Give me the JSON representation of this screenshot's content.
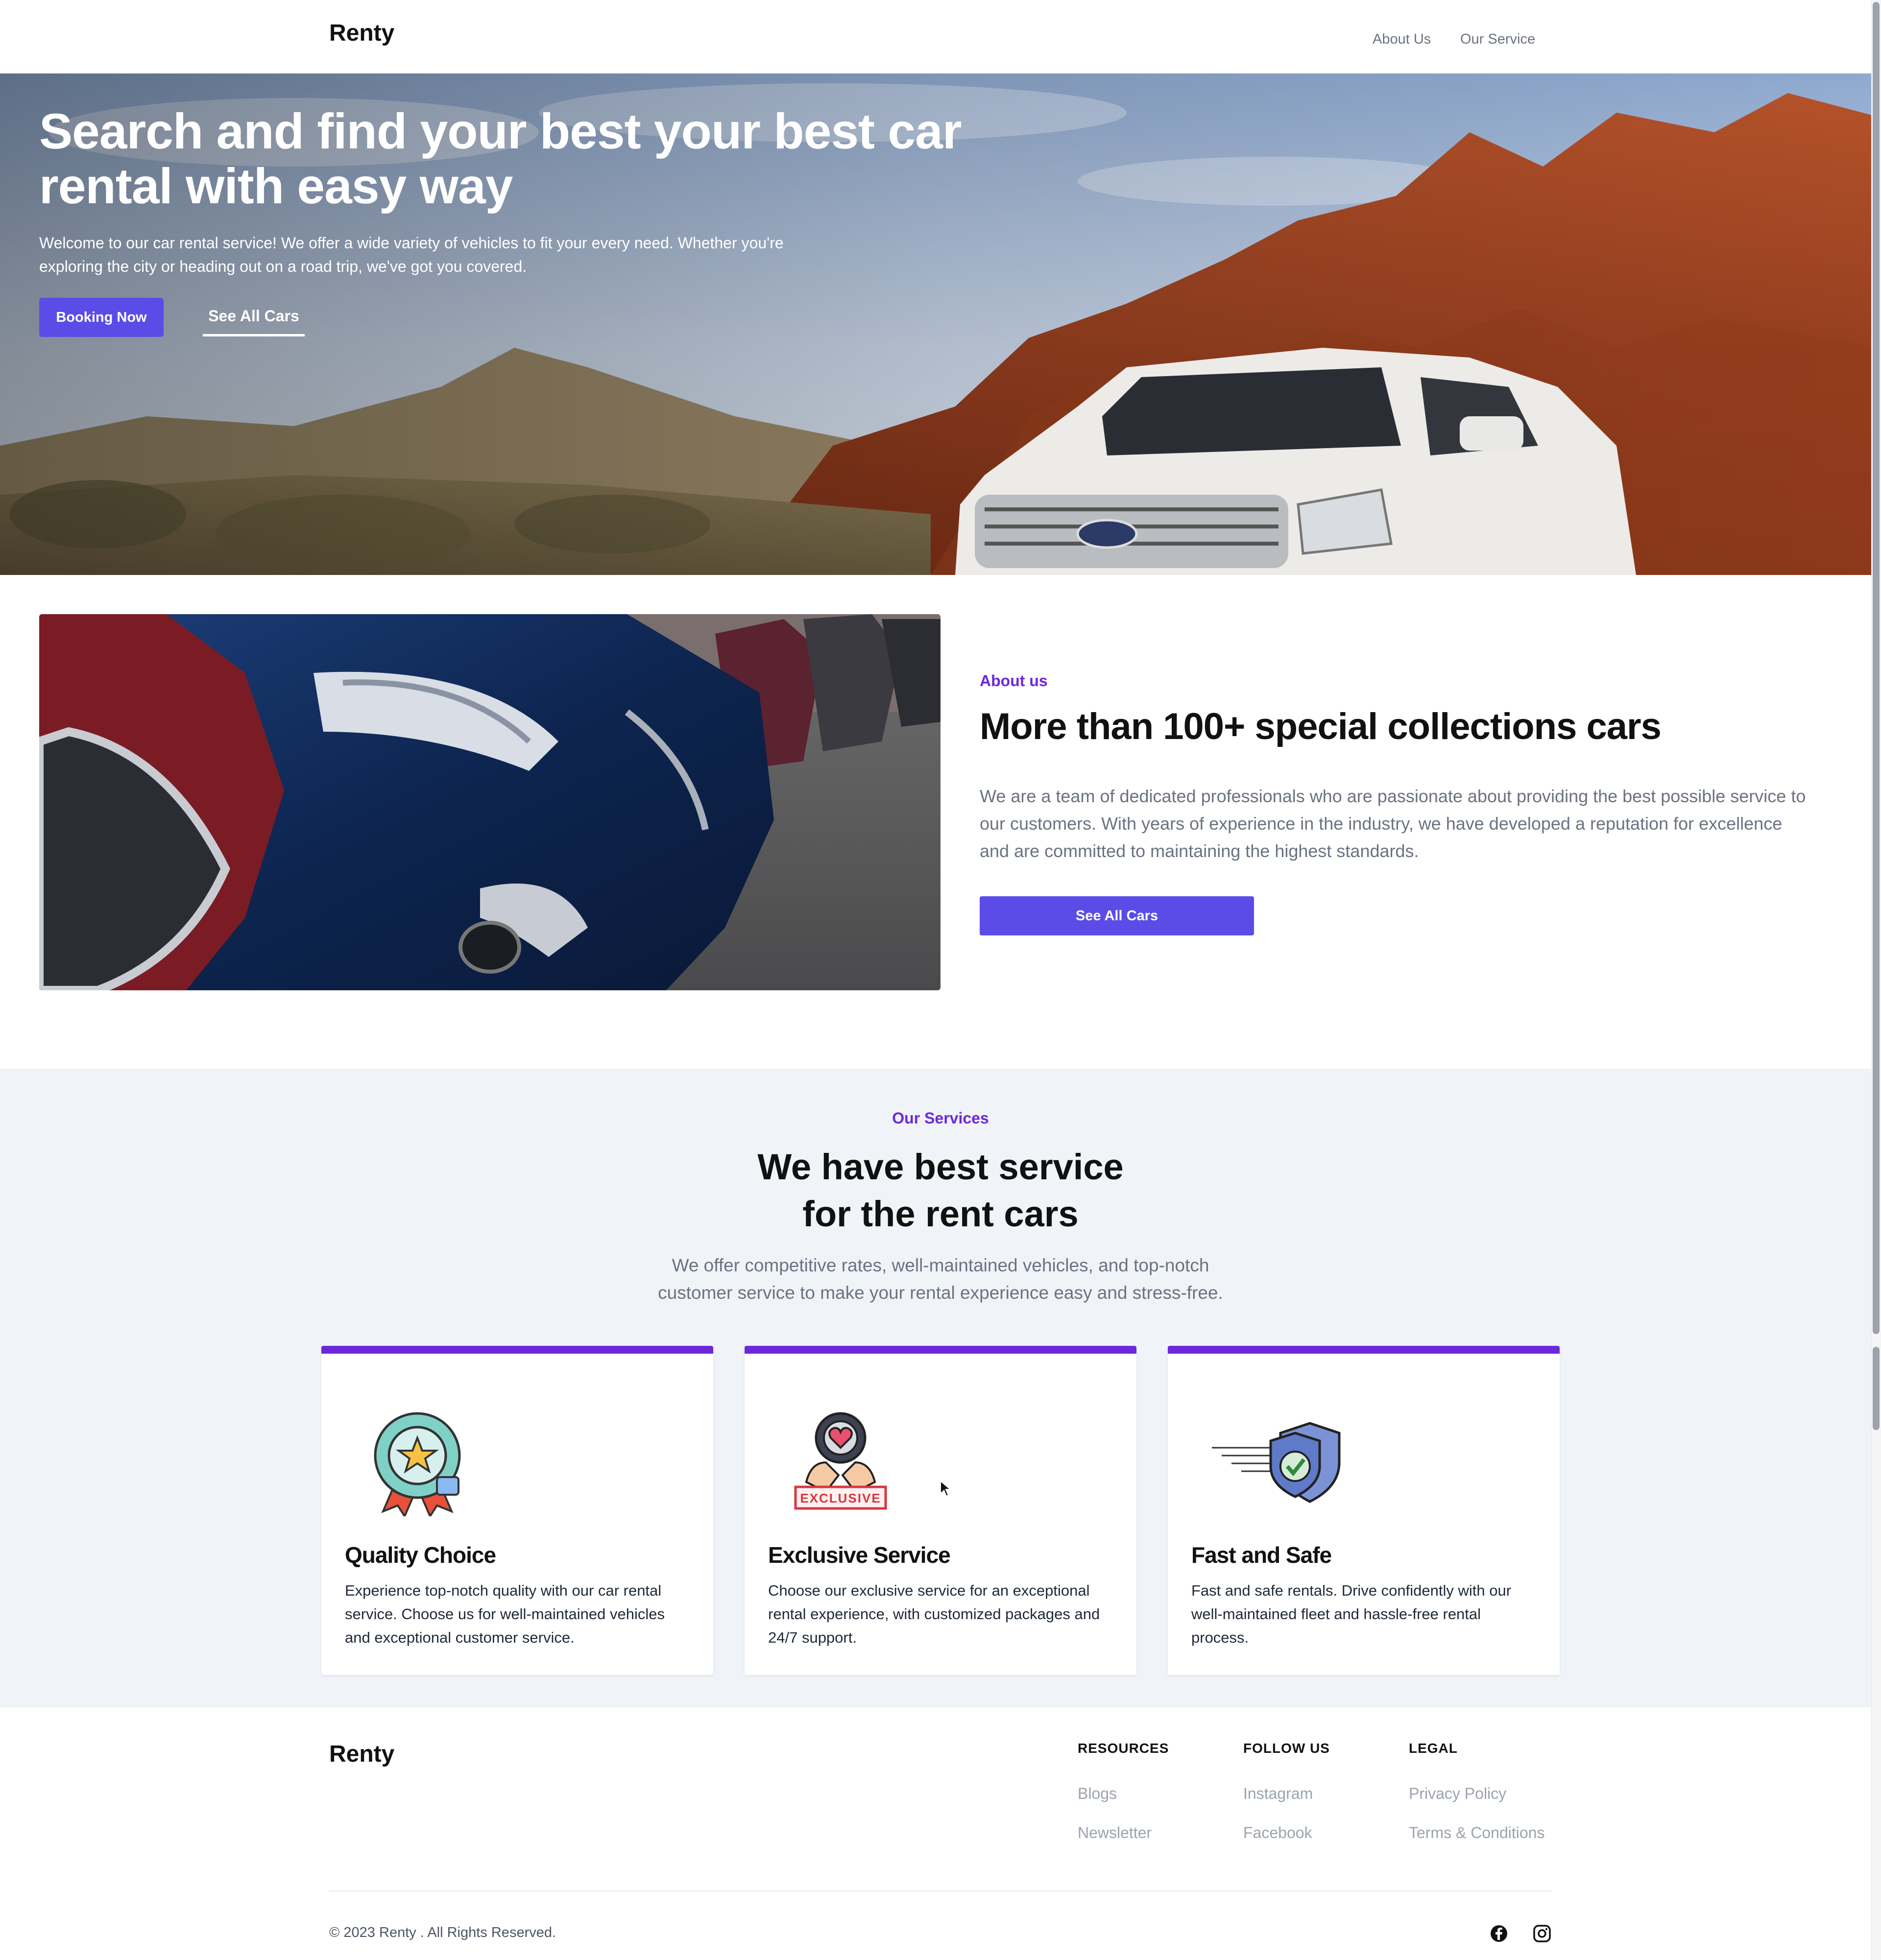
{
  "header": {
    "logo": "Renty",
    "nav": [
      "About Us",
      "Our Service"
    ]
  },
  "hero": {
    "title": "Search and find your best your best car rental with easy way",
    "text": "Welcome to our car rental service! We offer a wide variety of vehicles to fit your every need. Whether you're exploring the city or heading out on a road trip, we've got you covered.",
    "booking_label": "Booking Now",
    "see_all_label": "See All Cars"
  },
  "about": {
    "label": "About us",
    "title": "More than 100+ special collections cars",
    "text": "We are a team of dedicated professionals who are passionate about providing the best possible service to our customers. With years of experience in the industry, we have developed a reputation for excellence and are committed to maintaining the highest standards.",
    "button_label": "See All Cars"
  },
  "services": {
    "label": "Our Services",
    "title_line1": "We have best service",
    "title_line2": "for the rent cars",
    "text": "We offer competitive rates, well-maintained vehicles, and top-notch customer service to make your rental experience easy and stress-free.",
    "cards": [
      {
        "icon": "award-ribbon-icon",
        "title": "Quality Choice",
        "text": "Experience top-notch quality with our car rental service. Choose us for well-maintained vehicles and exceptional customer service."
      },
      {
        "icon": "exclusive-badge-icon",
        "badge": "EXCLUSIVE",
        "title": "Exclusive Service",
        "text": "Choose our exclusive service for an exceptional rental experience, with customized packages and 24/7 support."
      },
      {
        "icon": "shield-check-icon",
        "title": "Fast and Safe",
        "text": "Fast and safe rentals. Drive confidently with our well-maintained fleet and hassle-free rental process."
      }
    ]
  },
  "footer": {
    "logo": "Renty",
    "columns": [
      {
        "title": "RESOURCES",
        "links": [
          "Blogs",
          "Newsletter"
        ]
      },
      {
        "title": "FOLLOW US",
        "links": [
          "Instagram",
          "Facebook"
        ]
      },
      {
        "title": "LEGAL",
        "links": [
          "Privacy Policy",
          "Terms & Conditions"
        ]
      }
    ],
    "copyright": "© 2023 Renty . All Rights Reserved.",
    "social_icons": [
      "facebook-icon",
      "instagram-icon"
    ]
  },
  "colors": {
    "accent": "#5b4ce8",
    "purple": "#6d28d9",
    "services_bg": "#f0f3f8"
  }
}
